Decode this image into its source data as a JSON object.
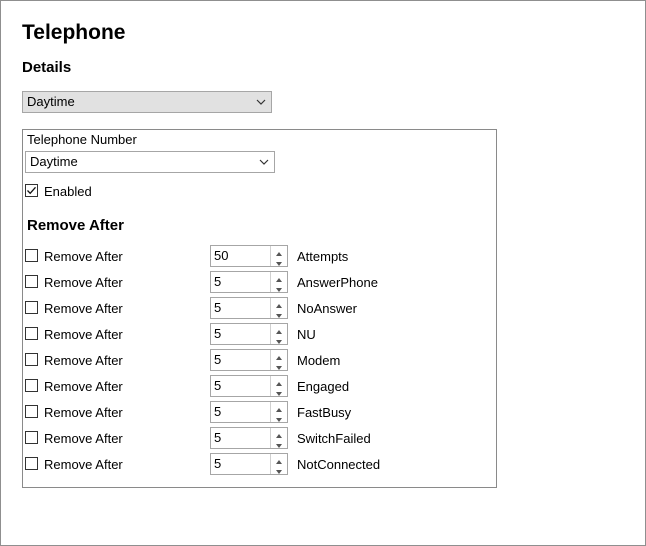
{
  "window": {
    "title": "Telephone",
    "section": "Details"
  },
  "topSelect": {
    "value": "Daytime"
  },
  "group": {
    "numberLabel": "Telephone Number",
    "numberSelect": {
      "value": "Daytime"
    },
    "enabled": {
      "label": "Enabled",
      "checked": true
    },
    "removeAfterTitle": "Remove After",
    "rows": [
      {
        "label": "Remove After",
        "checked": false,
        "value": "50",
        "reason": "Attempts"
      },
      {
        "label": "Remove After",
        "checked": false,
        "value": "5",
        "reason": "AnswerPhone"
      },
      {
        "label": "Remove After",
        "checked": false,
        "value": "5",
        "reason": "NoAnswer"
      },
      {
        "label": "Remove After",
        "checked": false,
        "value": "5",
        "reason": "NU"
      },
      {
        "label": "Remove After",
        "checked": false,
        "value": "5",
        "reason": "Modem"
      },
      {
        "label": "Remove After",
        "checked": false,
        "value": "5",
        "reason": "Engaged"
      },
      {
        "label": "Remove After",
        "checked": false,
        "value": "5",
        "reason": "FastBusy"
      },
      {
        "label": "Remove After",
        "checked": false,
        "value": "5",
        "reason": "SwitchFailed"
      },
      {
        "label": "Remove After",
        "checked": false,
        "value": "5",
        "reason": "NotConnected"
      }
    ]
  },
  "icons": {
    "dropdown": "chevron-down-icon",
    "check": "checkmark-icon",
    "spinUp": "caret-up-icon",
    "spinDown": "caret-down-icon"
  }
}
